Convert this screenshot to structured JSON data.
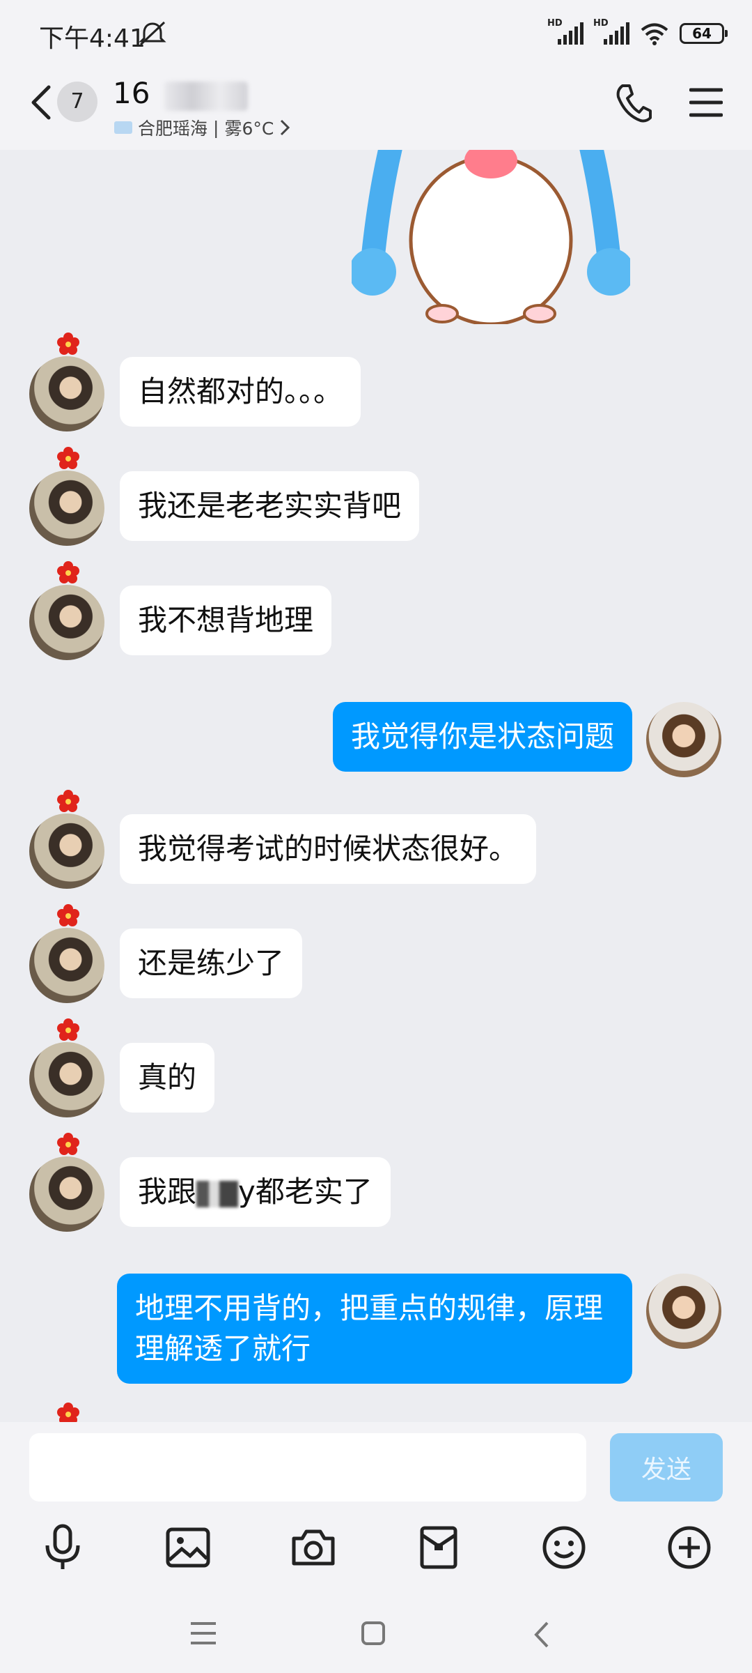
{
  "status_bar": {
    "time": "下午4:41",
    "signal_label": "HD",
    "battery": "64"
  },
  "header": {
    "unread_count": "7",
    "contact_name": "16",
    "location": "合肥瑶海",
    "separator": "|",
    "weather": "雾6°C"
  },
  "messages": [
    {
      "side": "left",
      "text": "自然都对的。。。"
    },
    {
      "side": "left",
      "text": "我还是老老实实背吧"
    },
    {
      "side": "left",
      "text": "我不想背地理"
    },
    {
      "side": "right",
      "text": "我觉得你是状态问题"
    },
    {
      "side": "left",
      "text": "我觉得考试的时候状态很好。"
    },
    {
      "side": "left",
      "text": "还是练少了"
    },
    {
      "side": "left",
      "text": "真的"
    },
    {
      "side": "left",
      "text_before": "我跟",
      "text_after": "y都老实了"
    },
    {
      "side": "right",
      "text": "地理不用背的，把重点的规律，原理理解透了就行"
    }
  ],
  "input": {
    "value": "",
    "placeholder": "",
    "send_label": "发送"
  },
  "toolbar": [
    "mic-icon",
    "image-icon",
    "camera-icon",
    "red-packet-icon",
    "emoji-icon",
    "plus-icon"
  ],
  "colors": {
    "accent": "#0099ff",
    "send_disabled": "#8fcdf6",
    "background": "#ecedf1"
  }
}
